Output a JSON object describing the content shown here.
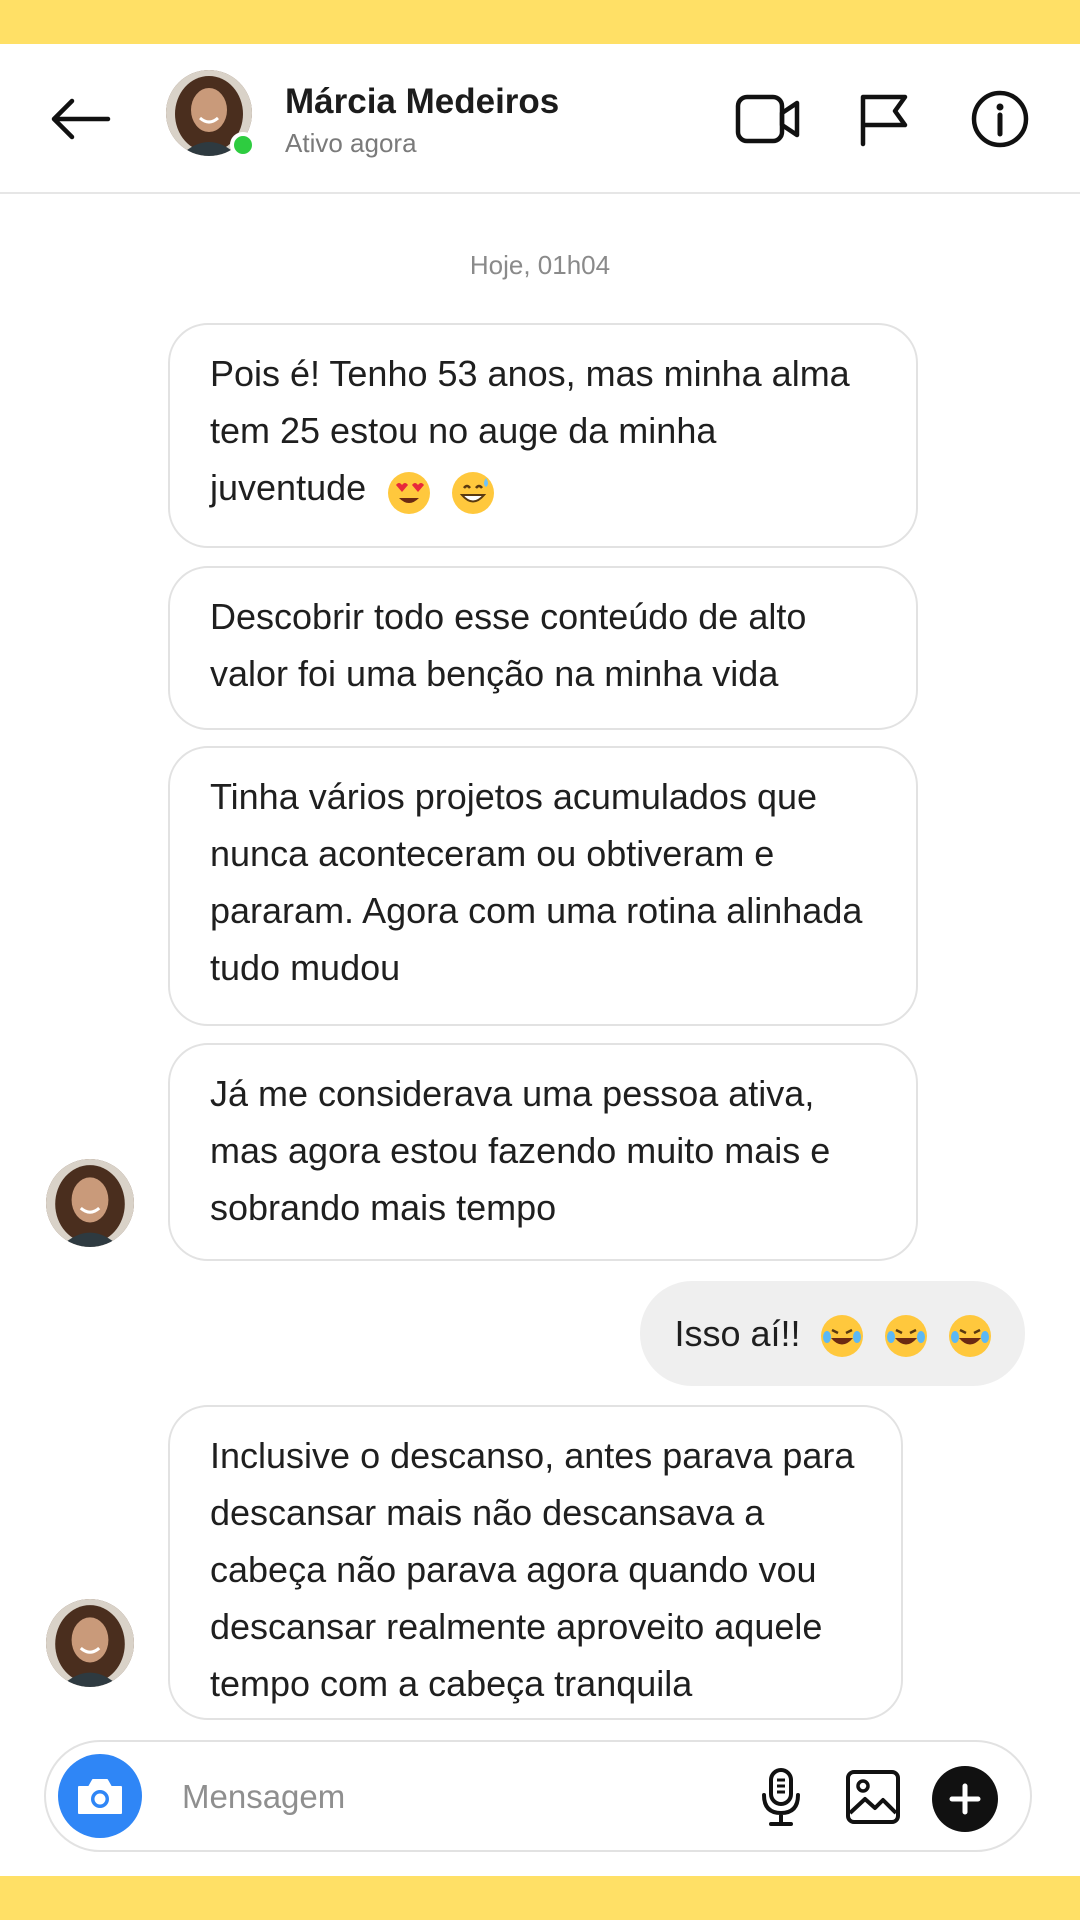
{
  "header": {
    "contact_name": "Márcia Medeiros",
    "status": "Ativo agora",
    "icons": [
      "back-arrow-icon",
      "video-call-icon",
      "flag-icon",
      "info-icon"
    ]
  },
  "timestamp": "Hoje, 01h04",
  "messages": [
    {
      "from": "contact",
      "text": "Pois é! Tenho 53 anos, mas minha alma tem 25 estou no auge da minha juventude",
      "emojis": [
        "heart-eyes-emoji",
        "grinning-sweat-emoji"
      ]
    },
    {
      "from": "contact",
      "text": "Descobrir todo esse conteúdo de alto valor foi uma benção na minha vida"
    },
    {
      "from": "contact",
      "text": "Tinha vários projetos acumulados que nunca aconteceram ou obtiveram e pararam. Agora com uma rotina alinhada tudo mudou"
    },
    {
      "from": "contact",
      "text": "Já me considerava uma pessoa ativa, mas agora estou fazendo muito mais e sobrando mais tempo"
    },
    {
      "from": "me",
      "text": "Isso aí!!",
      "emojis": [
        "tears-of-joy-emoji",
        "tears-of-joy-emoji",
        "tears-of-joy-emoji"
      ]
    },
    {
      "from": "contact",
      "text": "Inclusive o descanso, antes parava para descansar mais não descansava a cabeça não parava agora quando vou descansar realmente aproveito aquele tempo com a cabeça tranquila"
    }
  ],
  "composer": {
    "placeholder": "Mensagem",
    "icons": [
      "camera-icon",
      "microphone-icon",
      "gallery-icon",
      "plus-icon"
    ]
  },
  "colors": {
    "accent_band": "#FFE066",
    "camera_button": "#2f86f6",
    "online": "#2ecc40",
    "sent_bubble": "#efefef"
  }
}
